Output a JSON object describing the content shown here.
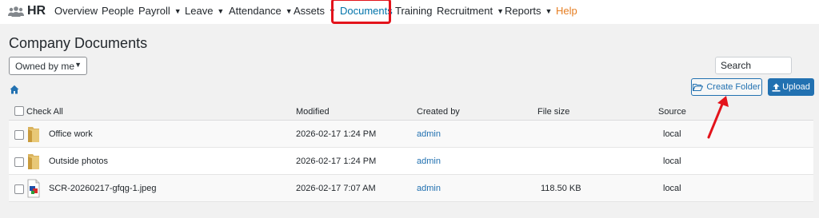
{
  "brand": {
    "name": "HR",
    "icon": "users-icon"
  },
  "nav": [
    {
      "label": "Overview",
      "has_caret": false
    },
    {
      "label": "People",
      "has_caret": false
    },
    {
      "label": "Payroll",
      "has_caret": true
    },
    {
      "label": "Leave",
      "has_caret": true
    },
    {
      "label": "Attendance",
      "has_caret": true
    },
    {
      "label": "Assets",
      "has_caret": true
    },
    {
      "label": "Documents",
      "has_caret": false,
      "active": true
    },
    {
      "label": "Training",
      "has_caret": false
    },
    {
      "label": "Recruitment",
      "has_caret": true
    },
    {
      "label": "Reports",
      "has_caret": true
    },
    {
      "label": "Help",
      "has_caret": false
    }
  ],
  "page": {
    "title": "Company Documents",
    "owner_filter": "Owned by me",
    "search_placeholder": "Search",
    "create_folder_label": "Create Folder",
    "upload_label": "Upload"
  },
  "table": {
    "headers": {
      "check_all": "Check All",
      "modified": "Modified",
      "created_by": "Created by",
      "file_size": "File size",
      "source": "Source"
    },
    "rows": [
      {
        "name": "Office work",
        "type": "folder",
        "modified": "2026-02-17 1:24 PM",
        "created_by": "admin",
        "file_size": "",
        "source": "local"
      },
      {
        "name": "Outside photos",
        "type": "folder",
        "modified": "2026-02-17 1:24 PM",
        "created_by": "admin",
        "file_size": "",
        "source": "local"
      },
      {
        "name": "SCR-20260217-gfqg-1.jpeg",
        "type": "image",
        "modified": "2026-02-17 7:07 AM",
        "created_by": "admin",
        "file_size": "118.50 KB",
        "source": "local"
      }
    ]
  },
  "colors": {
    "accent": "#2271b1",
    "highlight": "#e3131b",
    "help": "#e67e22"
  }
}
